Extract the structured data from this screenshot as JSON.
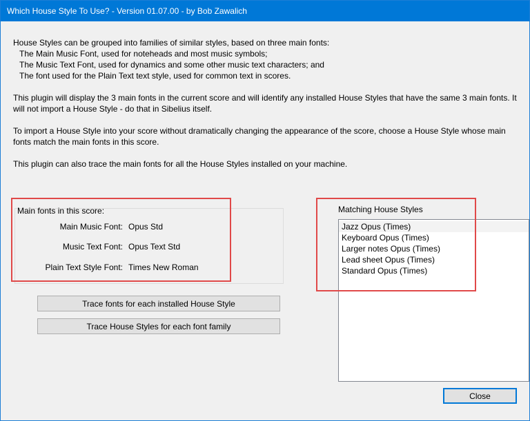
{
  "window": {
    "title": "Which House Style To Use? - Version 01.07.00 - by Bob Zawalich"
  },
  "description": {
    "line1": "House Styles can be grouped into families of similar styles, based on three main fonts:",
    "line2": "The Main Music Font, used for noteheads and most music symbols;",
    "line3": "The Music Text Font, used for dynamics and some other music text characters; and",
    "line4": "The font used for the Plain Text text style, used for common text in scores.",
    "para2": "This plugin will display the 3 main fonts in the current score and will identify any installed House Styles that have the same 3 main fonts. It will not import a House Style - do that in Sibelius itself.",
    "para3": "To import a House Style into your score without dramatically changing the appearance of the score, choose a House Style whose main fonts match the main fonts in this score.",
    "para4": "This plugin can also trace the main fonts for all the House Styles installed on your machine."
  },
  "main_fonts": {
    "heading": "Main fonts in this score:",
    "rows": [
      {
        "label": "Main Music Font:",
        "value": "Opus Std"
      },
      {
        "label": "Music Text Font:",
        "value": "Opus Text Std"
      },
      {
        "label": "Plain Text Style Font:",
        "value": "Times New Roman"
      }
    ]
  },
  "buttons": {
    "trace_fonts": "Trace fonts for each installed House Style",
    "trace_styles": "Trace House Styles for each font family",
    "close": "Close"
  },
  "matching": {
    "heading": "Matching House Styles",
    "items": [
      "Jazz Opus (Times)",
      "Keyboard Opus (Times)",
      "Larger notes Opus (Times)",
      "Lead sheet Opus (Times)",
      "Standard Opus (Times)"
    ],
    "selected_index": 0
  },
  "colors": {
    "titlebar": "#0078d7",
    "annotation": "#e04848",
    "background": "#f0f0f0"
  }
}
